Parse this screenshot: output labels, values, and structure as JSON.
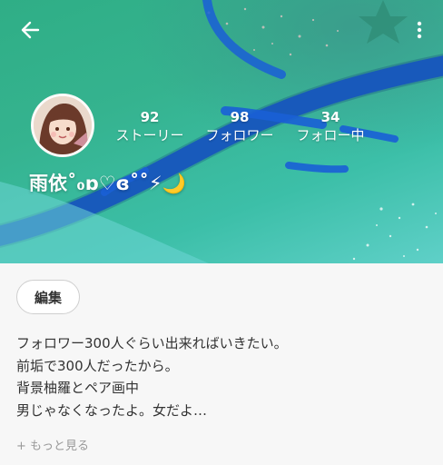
{
  "profile": {
    "username": "雨依˚₀ɒ♡ɞ˚˚⚡🌙",
    "stats": [
      {
        "value": "92",
        "label": "ストーリー"
      },
      {
        "value": "98",
        "label": "フォロワー"
      },
      {
        "value": "34",
        "label": "フォロー中"
      }
    ]
  },
  "actions": {
    "edit_label": "編集"
  },
  "bio": {
    "lines": [
      "フォロワー300人ぐらい出来ればいきたい。",
      "前垢で300人だったから。",
      "背景柚羅とペア画中",
      "男じゃなくなったよ。女だよ…"
    ],
    "more_label": "+ もっと見る"
  },
  "icons": {
    "back": "arrow-left-icon",
    "menu": "more-vertical-icon"
  },
  "colors": {
    "header_green": "#35b38f",
    "stroke_blue": "#1a5fd6"
  }
}
